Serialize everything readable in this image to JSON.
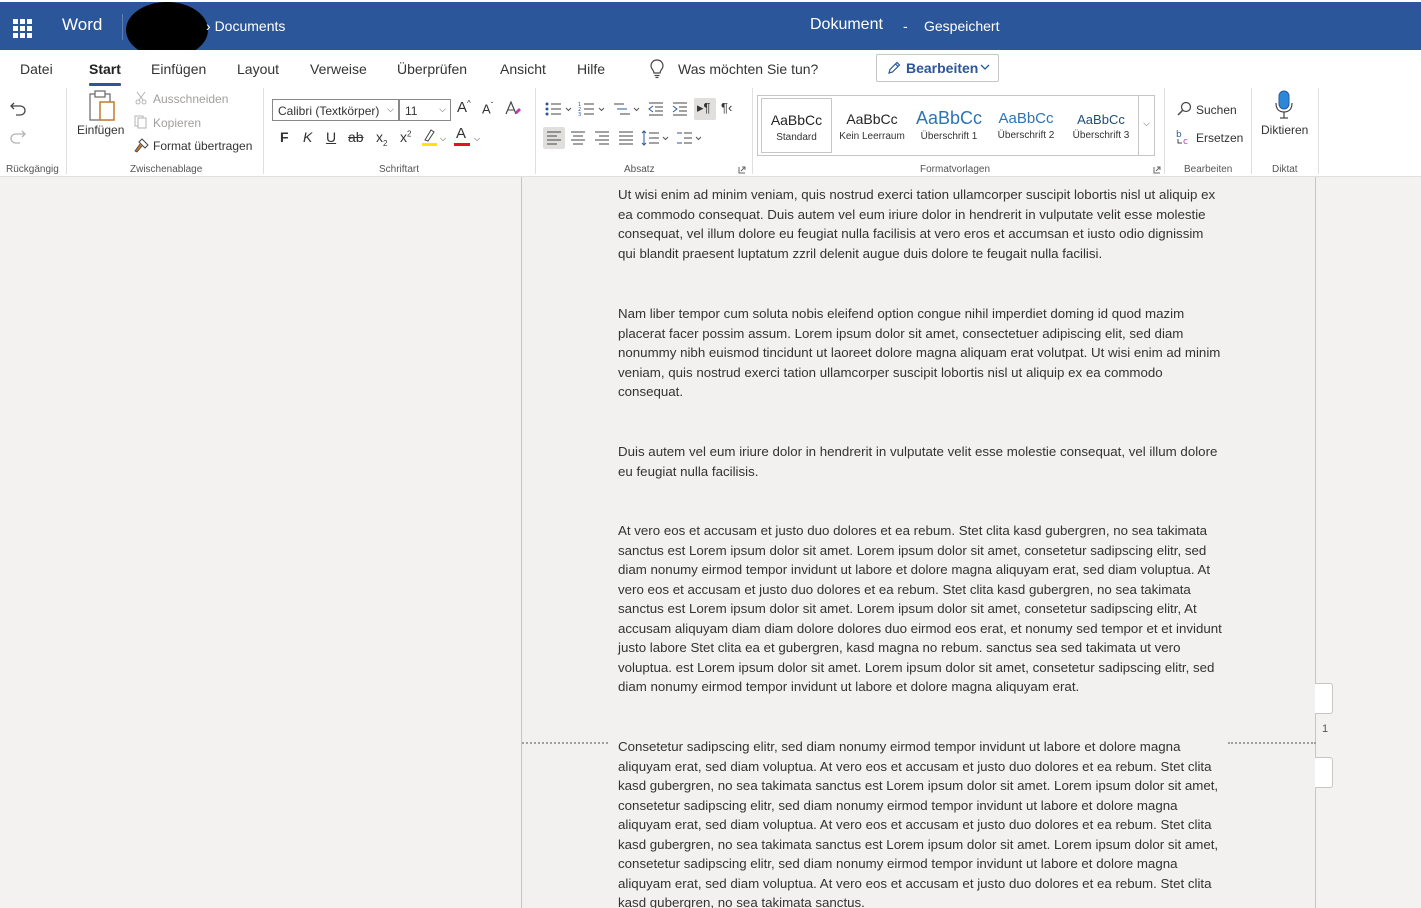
{
  "titlebar": {
    "app_name": "Word",
    "breadcrumb": "Documents",
    "doc_title": "Dokument",
    "separator": "-",
    "save_status": "Gespeichert"
  },
  "tabs": [
    "Datei",
    "Start",
    "Einfügen",
    "Layout",
    "Verweise",
    "Überprüfen",
    "Ansicht",
    "Hilfe"
  ],
  "active_tab": "Start",
  "tell_me": "Was möchten Sie tun?",
  "edit_mode": "Bearbeiten",
  "groups": {
    "undo": "Rückgängig",
    "clipboard": "Zwischenablage",
    "font": "Schriftart",
    "paragraph": "Absatz",
    "styles": "Formatvorlagen",
    "editing": "Bearbeiten",
    "dictate": "Diktat"
  },
  "clipboard": {
    "paste": "Einfügen",
    "cut": "Ausschneiden",
    "copy": "Kopieren",
    "format_painter": "Format übertragen"
  },
  "font": {
    "family": "Calibri (Textkörper)",
    "size": "11",
    "bold": "F",
    "italic": "K",
    "underline": "U",
    "strike": "ab",
    "subscript": "x",
    "superscript": "x",
    "font_color": "A"
  },
  "styles": [
    {
      "sample": "AaBbCc",
      "name": "Standard"
    },
    {
      "sample": "AaBbCc",
      "name": "Kein Leerraum"
    },
    {
      "sample": "AaBbCc",
      "name": "Überschrift 1"
    },
    {
      "sample": "AaBbCc",
      "name": "Überschrift 2"
    },
    {
      "sample": "AaBbCc",
      "name": "Überschrift 3"
    }
  ],
  "editing": {
    "find": "Suchen",
    "replace": "Ersetzen"
  },
  "dictate": "Diktieren",
  "document": {
    "paragraphs": [
      "Ut wisi enim ad minim veniam, quis nostrud exerci tation ullamcorper suscipit lobortis nisl ut aliquip ex ea commodo consequat. Duis autem vel eum iriure dolor in hendrerit in vulputate velit esse molestie consequat, vel illum dolore eu feugiat nulla facilisis at vero eros et accumsan et iusto odio dignissim qui blandit praesent luptatum zzril delenit augue duis dolore te feugait nulla facilisi.",
      "Nam liber tempor cum soluta nobis eleifend option congue nihil imperdiet doming id quod mazim placerat facer possim assum. Lorem ipsum dolor sit amet, consectetuer adipiscing elit, sed diam nonummy nibh euismod tincidunt ut laoreet dolore magna aliquam erat volutpat. Ut wisi enim ad minim veniam, quis nostrud exerci tation ullamcorper suscipit lobortis nisl ut aliquip ex ea commodo consequat.",
      "Duis autem vel eum iriure dolor in hendrerit in vulputate velit esse molestie consequat, vel illum dolore eu feugiat nulla facilisis.",
      "At vero eos et accusam et justo duo dolores et ea rebum. Stet clita kasd gubergren, no sea takimata sanctus est Lorem ipsum dolor sit amet. Lorem ipsum dolor sit amet, consetetur sadipscing elitr, sed diam nonumy eirmod tempor invidunt ut labore et dolore magna aliquyam erat, sed diam voluptua. At vero eos et accusam et justo duo dolores et ea rebum. Stet clita kasd gubergren, no sea takimata sanctus est Lorem ipsum dolor sit amet. Lorem ipsum dolor sit amet, consetetur sadipscing elitr, At accusam aliquyam diam diam dolore dolores duo eirmod eos erat, et nonumy sed tempor et et invidunt justo labore Stet clita ea et gubergren, kasd magna no rebum. sanctus sea sed takimata ut vero voluptua. est Lorem ipsum dolor sit amet. Lorem ipsum dolor sit amet, consetetur sadipscing elitr, sed diam nonumy eirmod tempor invidunt ut labore et dolore magna aliquyam erat.",
      "Consetetur sadipscing elitr, sed diam nonumy eirmod tempor invidunt ut labore et dolore magna aliquyam erat, sed diam voluptua. At vero eos et accusam et justo duo dolores et ea rebum. Stet clita kasd gubergren, no sea takimata sanctus est Lorem ipsum dolor sit amet. Lorem ipsum dolor sit amet, consetetur sadipscing elitr, sed diam nonumy eirmod tempor invidunt ut labore et dolore magna aliquyam erat, sed diam voluptua. At vero eos et accusam et justo duo dolores et ea rebum. Stet clita kasd gubergren, no sea takimata sanctus est Lorem ipsum dolor sit amet. Lorem ipsum dolor sit amet, consetetur sadipscing elitr, sed diam nonumy eirmod tempor invidunt ut labore et dolore magna aliquyam erat, sed diam voluptua. At vero eos et accusam et justo duo dolores et ea rebum. Stet clita kasd gubergren, no sea takimata sanctus."
    ],
    "page_number": "1"
  },
  "colors": {
    "brand": "#2b579a",
    "spell_squiggle": "#e81123",
    "highlight": "#ffe500",
    "font_color": "#e81123"
  }
}
